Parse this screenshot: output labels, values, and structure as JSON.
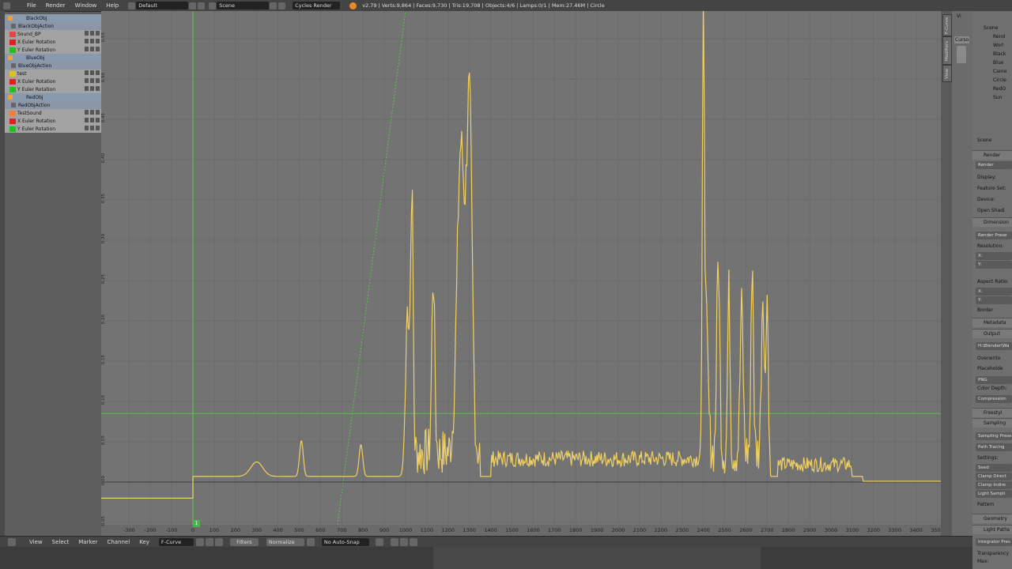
{
  "header": {
    "menus": [
      "File",
      "Render",
      "Window",
      "Help"
    ],
    "layout": "Default",
    "scene": "Scene",
    "engine": "Cycles Render",
    "stats": "v2.79 | Verts:9,864 | Faces:9,730 | Tris:19,708 | Objects:4/6 | Lamps:0/1 | Mem:27.46M | Circle"
  },
  "channels": [
    {
      "kind": "object",
      "label": "BlackObj"
    },
    {
      "kind": "action",
      "label": "BlackObjAction"
    },
    {
      "kind": "fcurve",
      "label": "Sound_BP",
      "color": "#e04848"
    },
    {
      "kind": "fcurve",
      "label": "X Euler Rotation",
      "color": "#e02020"
    },
    {
      "kind": "fcurve",
      "label": "Y Euler Rotation",
      "color": "#20c020"
    },
    {
      "kind": "object",
      "label": "BlueObj"
    },
    {
      "kind": "action",
      "label": "BlueObjAction"
    },
    {
      "kind": "fcurve",
      "label": "test",
      "color": "#e0c020"
    },
    {
      "kind": "fcurve",
      "label": "X Euler Rotation",
      "color": "#e02020"
    },
    {
      "kind": "fcurve",
      "label": "Y Euler Rotation",
      "color": "#20c020"
    },
    {
      "kind": "object",
      "label": "RedObj"
    },
    {
      "kind": "action",
      "label": "RedObjAction"
    },
    {
      "kind": "fcurve",
      "label": "TestSound",
      "color": "#f08040"
    },
    {
      "kind": "fcurve",
      "label": "X Euler Rotation",
      "color": "#e02020"
    },
    {
      "kind": "fcurve",
      "label": "Y Euler Rotation",
      "color": "#20c020"
    }
  ],
  "graph": {
    "y_ticks": [
      "0.60",
      "0.55",
      "0.50",
      "0.45",
      "0.40",
      "0.35",
      "0.30",
      "0.25",
      "0.20",
      "0.15",
      "0.10",
      "0.05",
      "0.00",
      "-0.05"
    ],
    "x_ticks": [
      "-300",
      "-200",
      "-100",
      "0",
      "100",
      "200",
      "300",
      "400",
      "500",
      "600",
      "700",
      "800",
      "900",
      "1000",
      "1100",
      "1200",
      "1300",
      "1400",
      "1500",
      "1600",
      "1700",
      "1800",
      "1900",
      "2000",
      "2100",
      "2200",
      "2300",
      "2400",
      "2500",
      "2600",
      "2700",
      "2800",
      "2900",
      "3000",
      "3100",
      "3200",
      "3300",
      "3400",
      "3500"
    ],
    "current_frame": "1",
    "curve_color": "#f0d060",
    "cursor_color": "#5ac24a"
  },
  "right_tabs": [
    "F-Curve",
    "Modifiers",
    "View"
  ],
  "outliner": {
    "items": [
      "Scene",
      "Rend",
      "Worl",
      "Black",
      "Blue",
      "Came",
      "Circle",
      "RedO",
      "Sun"
    ]
  },
  "view_label": "Vi",
  "cursor_label": "Curso",
  "properties": {
    "scene_label": "Scene",
    "render_head": "Render",
    "render_btn": "Render",
    "display": "Display:",
    "feature_set": "Feature Set:",
    "device": "Device:",
    "open_shading": "Open Shadi",
    "dimensions_head": "Dimension",
    "render_presets": "Render Prese",
    "resolution": "Resolution:",
    "res_x": "X:",
    "res_y": "Y:",
    "aspect": "Aspect Ratio:",
    "asp_x": "X:",
    "asp_y": "Y:",
    "border": "Border",
    "metadata_head": "Metadata",
    "output_head": "Output",
    "output_path": "H:\\Blender\\Wa",
    "overwrite": "Overwrite",
    "placeholders": "Placeholde",
    "png": "PNG",
    "color_depth": "Color Depth:",
    "compression": "Compression",
    "freestyle_head": "Freestyl",
    "sampling_head": "Sampling",
    "sampling_presets": "Sampling Prese",
    "path_tracing": "Path Tracing",
    "settings": "Settings:",
    "seed": "Seed",
    "clamp_direct": "Clamp Direct",
    "clamp_indirect": "Clamp Indire",
    "light_sampling": "Light Sampli",
    "pattern": "Pattern",
    "geometry_head": "Geometry",
    "light_paths_head": "Light Paths",
    "integrator_presets": "Integrator Pres",
    "transparency": "Transparency",
    "max": "Max:"
  },
  "footer": {
    "menus": [
      "View",
      "Select",
      "Marker",
      "Channel",
      "Key"
    ],
    "mode": "F-Curve",
    "filters": "Filters",
    "normalize": "Normalize",
    "autosnap": "No Auto-Snap"
  }
}
